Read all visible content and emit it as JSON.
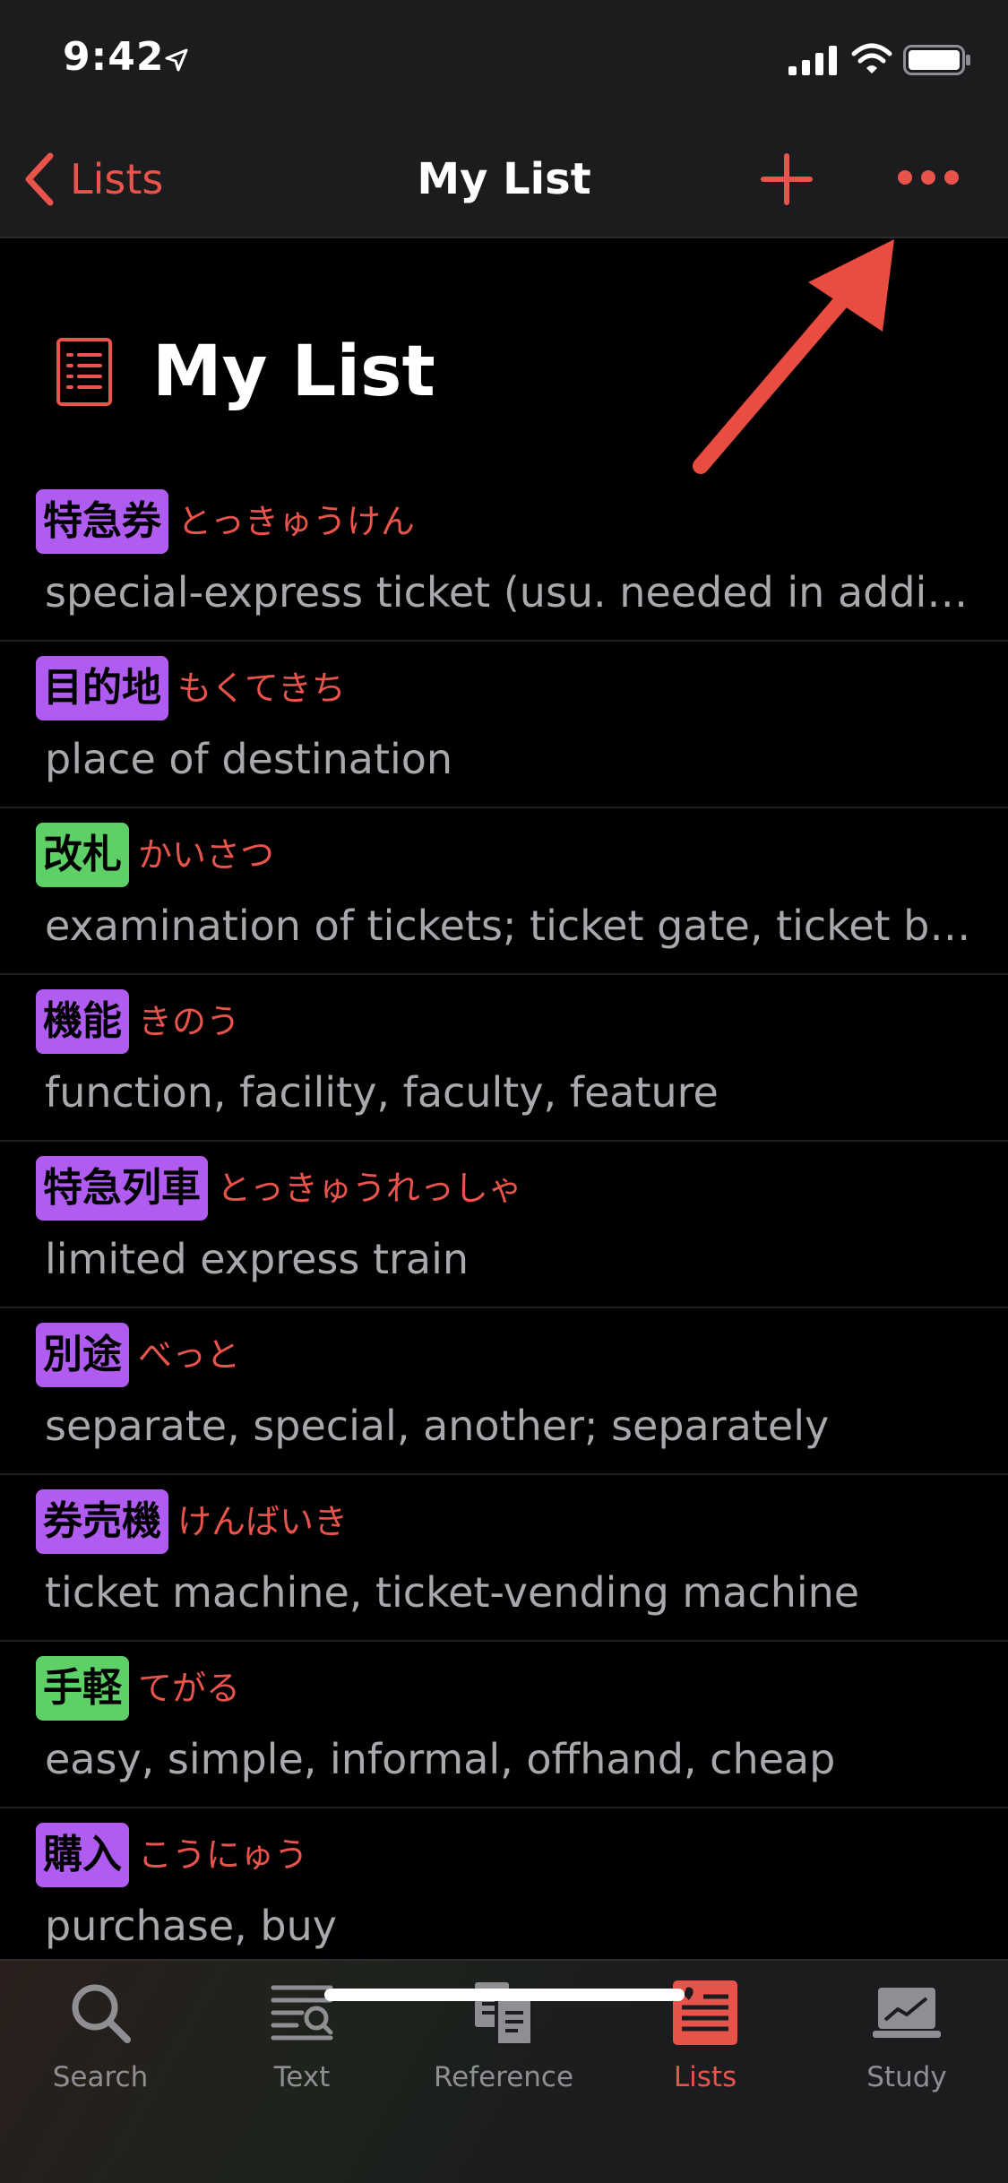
{
  "status_bar": {
    "time": "9:42"
  },
  "nav": {
    "back_label": "Lists",
    "title": "My List"
  },
  "header": {
    "title": "My List"
  },
  "entries": [
    {
      "kanji": "特急券",
      "reading": "とっきゅうけん",
      "definition": "special-express ticket (usu. needed in addi…",
      "color": "purple"
    },
    {
      "kanji": "目的地",
      "reading": "もくてきち",
      "definition": "place of destination",
      "color": "purple"
    },
    {
      "kanji": "改札",
      "reading": "かいさつ",
      "definition": "examination of tickets; ticket gate, ticket ba…",
      "color": "green"
    },
    {
      "kanji": "機能",
      "reading": "きのう",
      "definition": "function, facility, faculty, feature",
      "color": "purple"
    },
    {
      "kanji": "特急列車",
      "reading": "とっきゅうれっしゃ",
      "definition": "limited express train",
      "color": "purple"
    },
    {
      "kanji": "別途",
      "reading": "べっと",
      "definition": "separate, special, another; separately",
      "color": "purple"
    },
    {
      "kanji": "券売機",
      "reading": "けんばいき",
      "definition": "ticket machine, ticket-vending machine",
      "color": "purple"
    },
    {
      "kanji": "手軽",
      "reading": "てがる",
      "definition": "easy, simple, informal, offhand, cheap",
      "color": "green"
    },
    {
      "kanji": "購入",
      "reading": "こうにゅう",
      "definition": "purchase, buy",
      "color": "purple"
    }
  ],
  "tabs": [
    {
      "label": "Search",
      "icon": "search-icon",
      "active": false
    },
    {
      "label": "Text",
      "icon": "text-icon",
      "active": false
    },
    {
      "label": "Reference",
      "icon": "reference-icon",
      "active": false
    },
    {
      "label": "Lists",
      "icon": "lists-icon",
      "active": true
    },
    {
      "label": "Study",
      "icon": "study-icon",
      "active": false
    }
  ],
  "colors": {
    "accent": "#e8534b",
    "kanji_purple": "#b15cf0",
    "kanji_green": "#5fd068"
  }
}
